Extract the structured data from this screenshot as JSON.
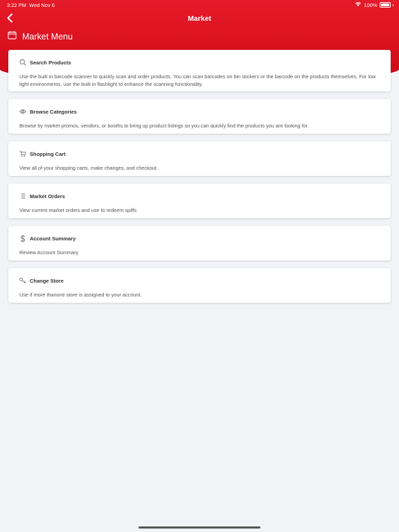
{
  "status": {
    "time": "3:22 PM",
    "date": "Wed Nov 6",
    "battery": "100%"
  },
  "nav": {
    "title": "Market",
    "back_icon": "chevron-left-icon"
  },
  "menu": {
    "heading": "Market Menu",
    "icon": "calendar-icon"
  },
  "cards": [
    {
      "icon": "search-icon",
      "title": "Search Products",
      "description": "Use the built in barcode scanner to quickly scan and order products. You can scan barcodes on bin stickers or the barcode on the products themselves. For low light environments, use the built in flashlight to enhance the scanning functionality."
    },
    {
      "icon": "eye-icon",
      "title": "Browse Categories",
      "description": "Browse by market promos, vendors, or booths to bring up product listings so you can quickly find the products you are looking for."
    },
    {
      "icon": "cart-icon",
      "title": "Shopping Cart",
      "description": "View all of your shopping carts, make changes, and checkout."
    },
    {
      "icon": "list-icon",
      "title": "Market Orders",
      "description": "View current market orders and use to redeem spiffs"
    },
    {
      "icon": "dollar-icon",
      "title": "Account Summary",
      "description": "Review Account Summary"
    },
    {
      "icon": "key-icon",
      "title": "Change Store",
      "description": "Use if more thanone store is assigned to your account."
    }
  ],
  "colors": {
    "brand": "#e0141f",
    "background": "#f2f3f6",
    "card": "#ffffff"
  }
}
